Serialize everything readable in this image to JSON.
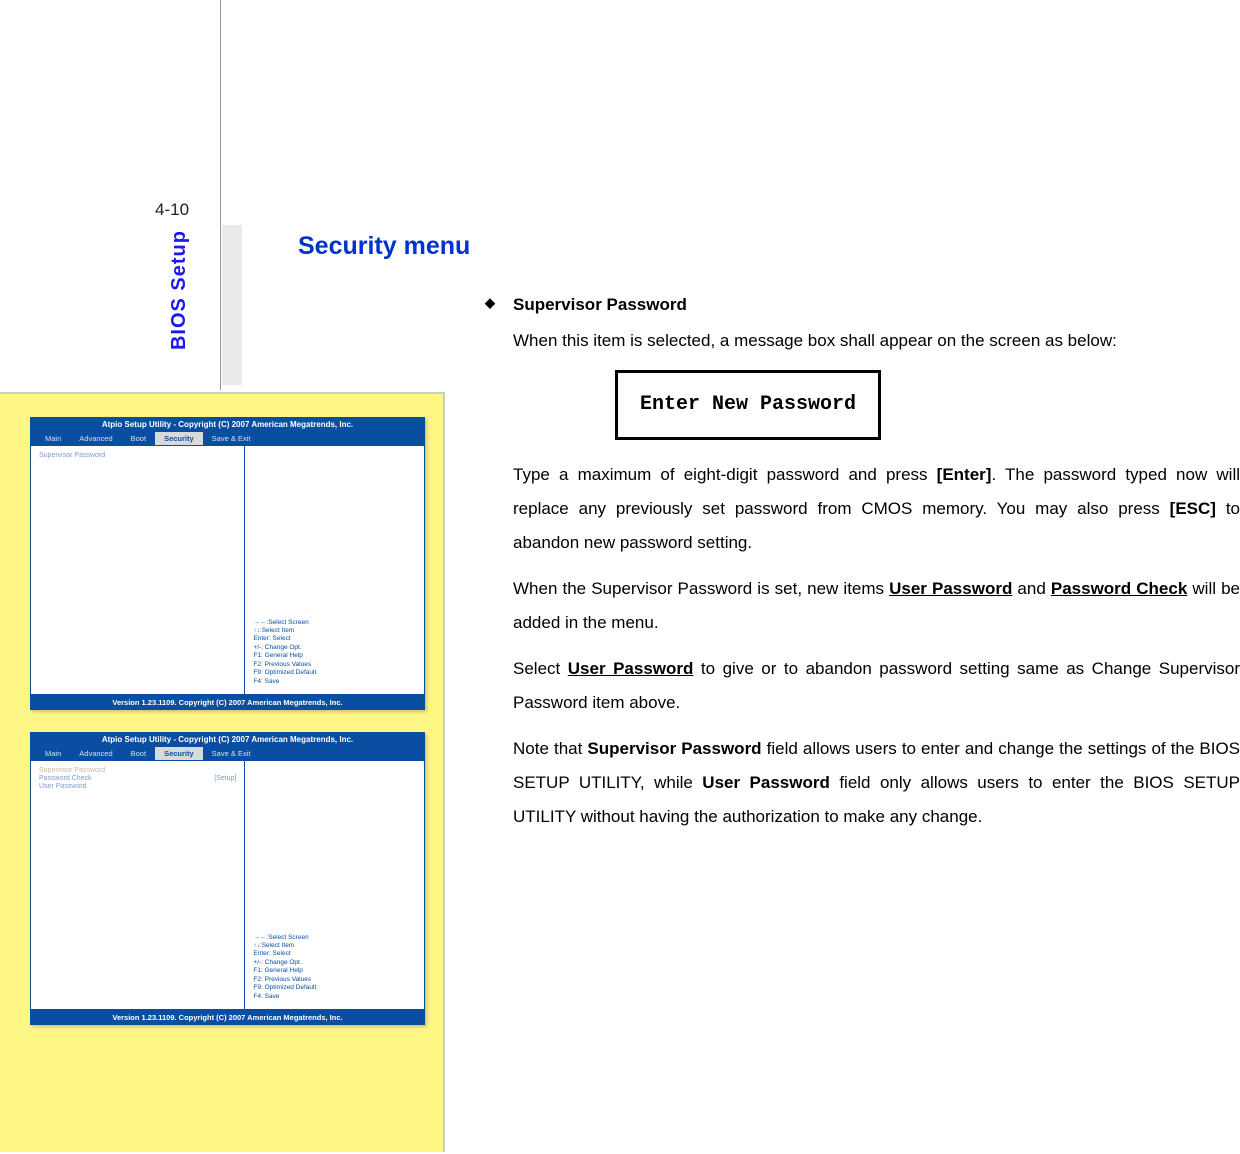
{
  "page_number": "4-10",
  "side_label": "BIOS Setup",
  "heading": "Security menu",
  "bullet_title": "Supervisor Password",
  "intro_text": "When this item is selected, a message box shall appear on the screen as below:",
  "message_box": "Enter New Password",
  "para2_pre": "Type a maximum of eight-digit password and press ",
  "para2_b1": "[Enter]",
  "para2_mid": ".  The password typed now will replace any previously set password from CMOS memory. You may also press ",
  "para2_b2": "[ESC]",
  "para2_post": " to abandon new password setting.",
  "para3_pre": "When the Supervisor Password is set, new items ",
  "para3_u1": "User Password",
  "para3_mid": " and ",
  "para3_u2": "Password Check",
  "para3_post": " will be added in the menu.",
  "para4_pre": "Select ",
  "para4_u1": "User Password",
  "para4_post": " to give or to abandon password setting same as Change Supervisor Password item above.",
  "para5_pre": "Note that ",
  "para5_b1": "Supervisor Password",
  "para5_mid": " field allows users to enter and change the settings of the BIOS SETUP UTILITY, while ",
  "para5_b2": "User Password",
  "para5_post": " field only allows users to enter the BIOS SETUP UTILITY without having the authorization to make any change.",
  "bios": {
    "title": "Atpio Setup Utility - Copyright (C) 2007 American Megatrends, Inc.",
    "footer": "Version 1.23.1109. Copyright (C) 2007 American Megatrends, Inc.",
    "tabs": [
      "Main",
      "Advanced",
      "Boot",
      "Security",
      "Save & Exit"
    ],
    "active_tab": "Security",
    "screen1_items": [
      {
        "label": "Supervisor Password",
        "value": ""
      }
    ],
    "screen2_items": [
      {
        "label": "Supervisor Password",
        "value": "",
        "dim": true
      },
      {
        "label": "Password Check",
        "value": "[Setup]"
      },
      {
        "label": "User Password",
        "value": ""
      }
    ],
    "help_lines": "→←:Select Screen\n↑↓:Select Item\nEnter: Select\n+/-: Change Opt.\nF1: General Help\nF2: Previous Values\nF9: Optimized Default\nF4: Save"
  }
}
